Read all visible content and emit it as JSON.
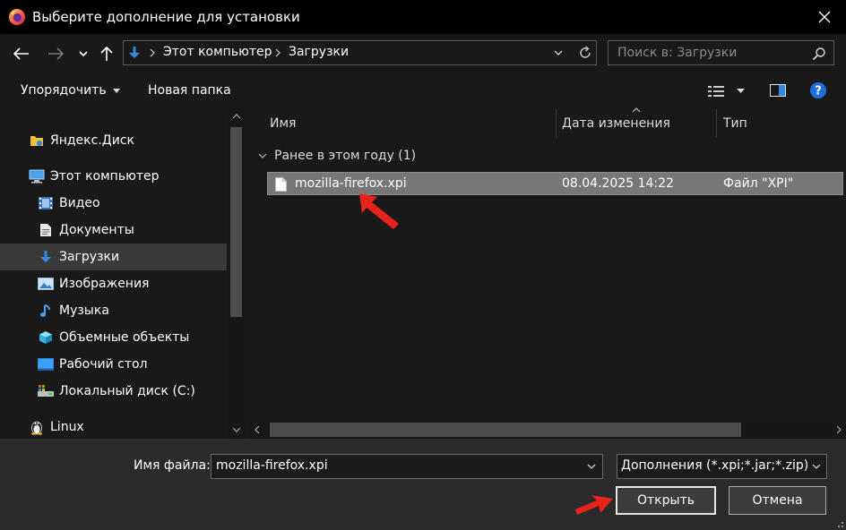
{
  "window": {
    "title": "Выберите дополнение для установки"
  },
  "nav": {
    "breadcrumb": [
      "Этот компьютер",
      "Загрузки"
    ],
    "search_placeholder": "Поиск в: Загрузки"
  },
  "toolbar": {
    "organize": "Упорядочить",
    "new_folder": "Новая папка"
  },
  "sidebar": {
    "items": [
      {
        "label": "Яндекс.Диск",
        "icon": "yandex-disk-icon"
      },
      {
        "label": "Этот компьютер",
        "icon": "computer-icon"
      },
      {
        "label": "Видео",
        "icon": "video-icon"
      },
      {
        "label": "Документы",
        "icon": "documents-icon"
      },
      {
        "label": "Загрузки",
        "icon": "downloads-icon",
        "selected": true
      },
      {
        "label": "Изображения",
        "icon": "pictures-icon"
      },
      {
        "label": "Музыка",
        "icon": "music-icon"
      },
      {
        "label": "Объемные объекты",
        "icon": "3d-objects-icon"
      },
      {
        "label": "Рабочий стол",
        "icon": "desktop-icon"
      },
      {
        "label": "Локальный диск (C:)",
        "icon": "local-disk-icon"
      },
      {
        "label": "Linux",
        "icon": "linux-icon"
      }
    ]
  },
  "columns": {
    "name": "Имя",
    "date": "Дата изменения",
    "type": "Тип"
  },
  "group": {
    "label": "Ранее в этом году (1)"
  },
  "files": [
    {
      "name": "mozilla-firefox.xpi",
      "date": "08.04.2025 14:22",
      "type": "Файл \"XPI\""
    }
  ],
  "bottom": {
    "filename_label": "Имя файла:",
    "filename_value": "mozilla-firefox.xpi",
    "filter": "Дополнения (*.xpi;*.jar;*.zip)",
    "open": "Открыть",
    "cancel": "Отмена"
  },
  "colors": {
    "annotation_arrow": "#e8231c",
    "selection": "#777777",
    "folder_accent": "#2f8ae0"
  }
}
